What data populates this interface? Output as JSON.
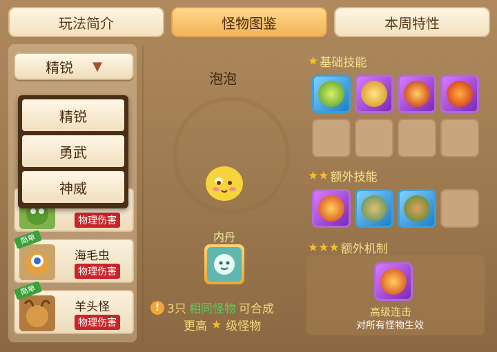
{
  "tabs": [
    {
      "label": "玩法简介"
    },
    {
      "label": "怪物图鉴"
    },
    {
      "label": "本周特性"
    }
  ],
  "filter": {
    "selected": "精锐"
  },
  "dropdown_options": [
    "精锐",
    "勇武",
    "神威"
  ],
  "monsters": [
    {
      "name": "",
      "type": "物理伤害",
      "badge": ""
    },
    {
      "name": "海毛虫",
      "type": "物理伤害",
      "badge": "简单"
    },
    {
      "name": "羊头怪",
      "type": "物理伤害",
      "badge": "简单"
    }
  ],
  "detail": {
    "name": "泡泡",
    "neidan_label": "内丹",
    "note_prefix": "3只",
    "note_highlight": "相同怪物",
    "note_suffix": "可合成",
    "note_line2_a": "更高",
    "note_line2_b": "级怪物"
  },
  "sections": {
    "basic": "基础技能",
    "extra_skill": "额外技能",
    "extra_mech": "额外机制"
  },
  "mechanism": {
    "name": "高级连击",
    "desc": "对所有怪物生效"
  },
  "colors": {
    "accent_tab": "#f2b35a",
    "type_badge": "#c8252a",
    "simple_badge": "#3aa13a",
    "highlight_text": "#58d05a"
  }
}
